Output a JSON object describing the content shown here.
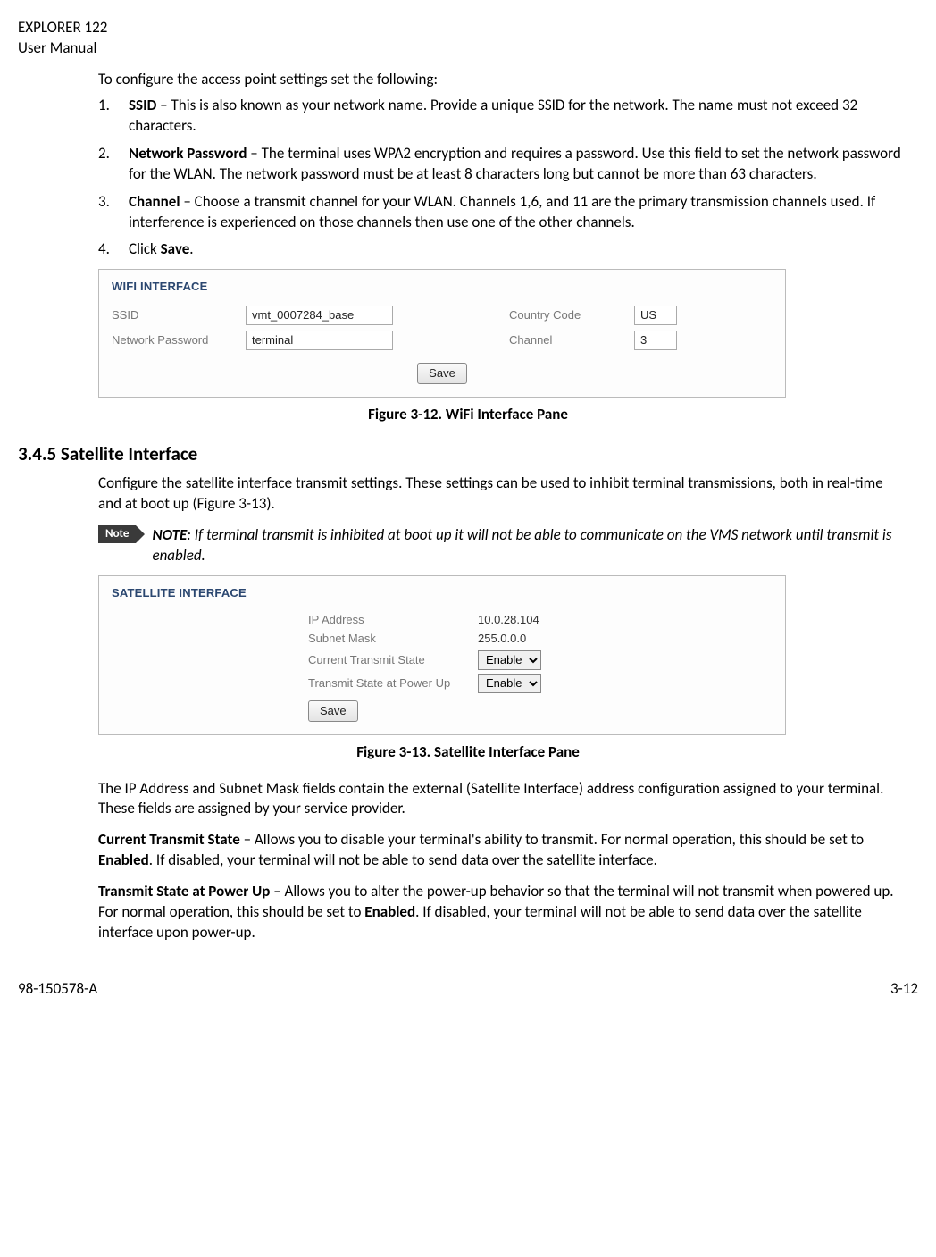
{
  "header": {
    "line1": "EXPLORER 122",
    "line2": "User Manual"
  },
  "intro": "To configure the access point settings set the following:",
  "steps": [
    {
      "bold": "SSID",
      "text": " – This is also known as your network name.  Provide a unique SSID for the network. The name must not exceed 32 characters."
    },
    {
      "bold": "Network Password",
      "text": " – The terminal uses WPA2 encryption and requires a password.  Use this field to set the network password for the WLAN. The network password must be at least 8 characters long but cannot be more than 63 characters."
    },
    {
      "bold": "Channel",
      "text": " – Choose a transmit channel for your WLAN. Channels 1,6, and 11 are the primary transmission channels used. If interference is experienced on those channels then use one of the other channels."
    },
    {
      "plain_pre": "Click ",
      "bold": "Save",
      "plain_post": "."
    }
  ],
  "wifi": {
    "title": "WIFI INTERFACE",
    "ssid_label": "SSID",
    "ssid_value": "vmt_0007284_base",
    "password_label": "Network Password",
    "password_value": "terminal",
    "country_label": "Country Code",
    "country_value": "US",
    "channel_label": "Channel",
    "channel_value": "3",
    "save": "Save"
  },
  "caption1": "Figure 3-12. WiFi Interface Pane",
  "section": {
    "num": "3.4.5",
    "title": "Satellite Interface",
    "intro": "Configure the satellite interface transmit settings. These settings can be used to inhibit terminal transmissions, both in real-time and at boot up (Figure 3-13).",
    "note_label": "Note",
    "note_bold": "NOTE",
    "note_text": ": If terminal transmit is inhibited at boot up it will not be able to communicate on the VMS network until transmit is enabled."
  },
  "sat": {
    "title": "SATELLITE INTERFACE",
    "ip_label": "IP Address",
    "ip_value": "10.0.28.104",
    "mask_label": "Subnet Mask",
    "mask_value": "255.0.0.0",
    "cur_label": "Current Transmit State",
    "cur_value": "Enable",
    "pow_label": "Transmit State at Power Up",
    "pow_value": "Enable",
    "save": "Save"
  },
  "caption2": "Figure 3-13. Satellite Interface Pane",
  "para1": "The IP Address and Subnet Mask fields contain the external (Satellite Interface) address configuration assigned to your terminal.  These fields are assigned by your service provider.",
  "para2": {
    "bold": "Current Transmit State",
    "rest": " – Allows you to disable your terminal's ability to transmit.  For normal operation, this should be set to ",
    "bold2": "Enabled",
    "rest2": ". If disabled, your terminal will not be able to send data over the satellite interface."
  },
  "para3": {
    "bold": "Transmit State at Power Up",
    "rest": " – Allows you to alter the power-up behavior so that the terminal will not transmit when powered up.  For normal operation, this should be set to ",
    "bold2": "Enabled",
    "rest2": ".  If disabled, your terminal will not be able to send data over the satellite interface upon power-up."
  },
  "footer": {
    "left": "98-150578-A",
    "right": "3-12"
  }
}
